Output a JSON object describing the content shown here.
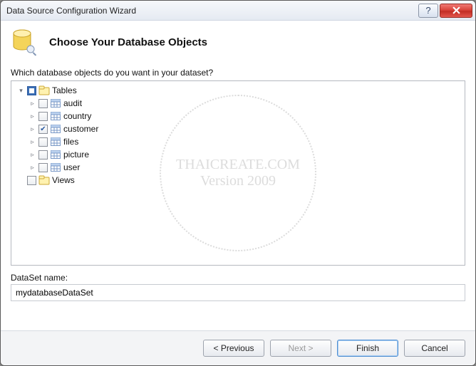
{
  "window": {
    "title": "Data Source Configuration Wizard"
  },
  "header": {
    "heading": "Choose Your Database Objects"
  },
  "prompt": "Which database objects do you want in your dataset?",
  "tree": {
    "tables_label": "Tables",
    "views_label": "Views",
    "tables": [
      {
        "name": "audit",
        "checked": false
      },
      {
        "name": "country",
        "checked": false
      },
      {
        "name": "customer",
        "checked": true
      },
      {
        "name": "files",
        "checked": false
      },
      {
        "name": "picture",
        "checked": false
      },
      {
        "name": "user",
        "checked": false
      }
    ]
  },
  "watermark": {
    "line1": "THAICREATE.COM",
    "line2": "Version 2009"
  },
  "dataset": {
    "label": "DataSet name:",
    "value": "mydatabaseDataSet"
  },
  "buttons": {
    "previous": "< Previous",
    "next": "Next >",
    "finish": "Finish",
    "cancel": "Cancel"
  }
}
